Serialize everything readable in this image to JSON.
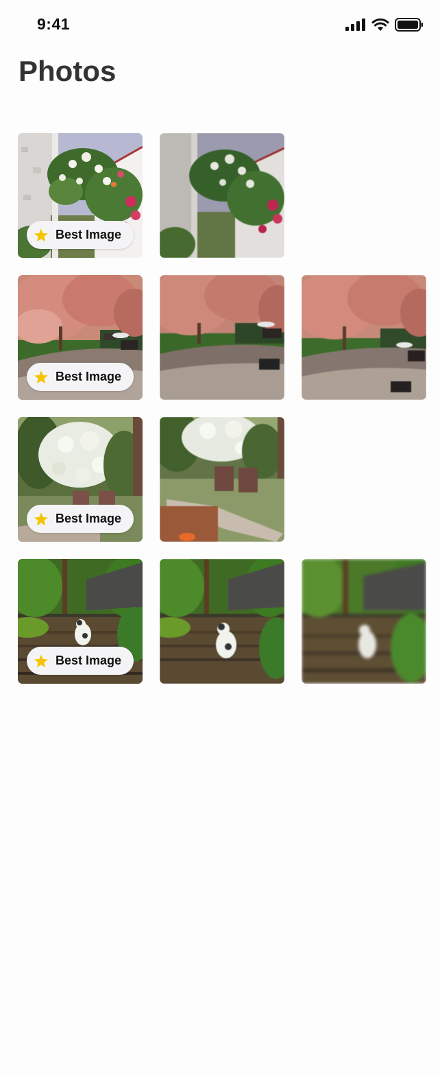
{
  "status_bar": {
    "time": "9:41"
  },
  "header": {
    "title": "Photos"
  },
  "badge_label": "Best Image",
  "colors": {
    "star": "#f5c400",
    "badge_bg": "#f4f4f6",
    "title": "#333333"
  },
  "groups": [
    {
      "subject": "house-with-flowering-vine",
      "photos": 2,
      "best_index": 0
    },
    {
      "subject": "park-with-pink-trees",
      "photos": 3,
      "best_index": 0
    },
    {
      "subject": "garden-benches-under-white-tree",
      "photos": 2,
      "best_index": 0
    },
    {
      "subject": "cat-on-garden-steps",
      "photos": 3,
      "best_index": 0
    }
  ]
}
